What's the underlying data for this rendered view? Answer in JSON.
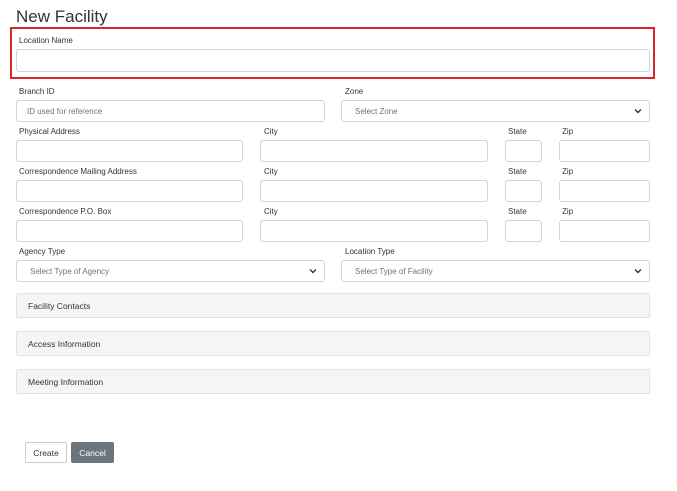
{
  "page": {
    "title": "New Facility"
  },
  "fields": {
    "location_name": {
      "label": "Location Name",
      "value": "",
      "placeholder": ""
    },
    "branch_id": {
      "label": "Branch ID",
      "value": "",
      "placeholder": "ID used for reference"
    },
    "zone": {
      "label": "Zone",
      "selected": "Select Zone"
    },
    "physical_address": {
      "label": "Physical Address",
      "city_label": "City",
      "state_label": "State",
      "zip_label": "Zip"
    },
    "mailing_address": {
      "label": "Correspondence Mailing Address",
      "city_label": "City",
      "state_label": "State",
      "zip_label": "Zip"
    },
    "po_box": {
      "label": "Correspondence P.O. Box",
      "city_label": "City",
      "state_label": "State",
      "zip_label": "Zip"
    },
    "agency_type": {
      "label": "Agency Type",
      "selected": "Select Type of Agency"
    },
    "location_type": {
      "label": "Location Type",
      "selected": "Select Type of Facility"
    }
  },
  "sections": [
    {
      "label": "Facility Contacts"
    },
    {
      "label": "Access Information"
    },
    {
      "label": "Meeting Information"
    }
  ],
  "buttons": {
    "create": "Create",
    "cancel": "Cancel"
  },
  "colors": {
    "highlight": "#d9262a",
    "cancel_bg": "#6c757d",
    "section_bg": "#f5f5f5"
  }
}
